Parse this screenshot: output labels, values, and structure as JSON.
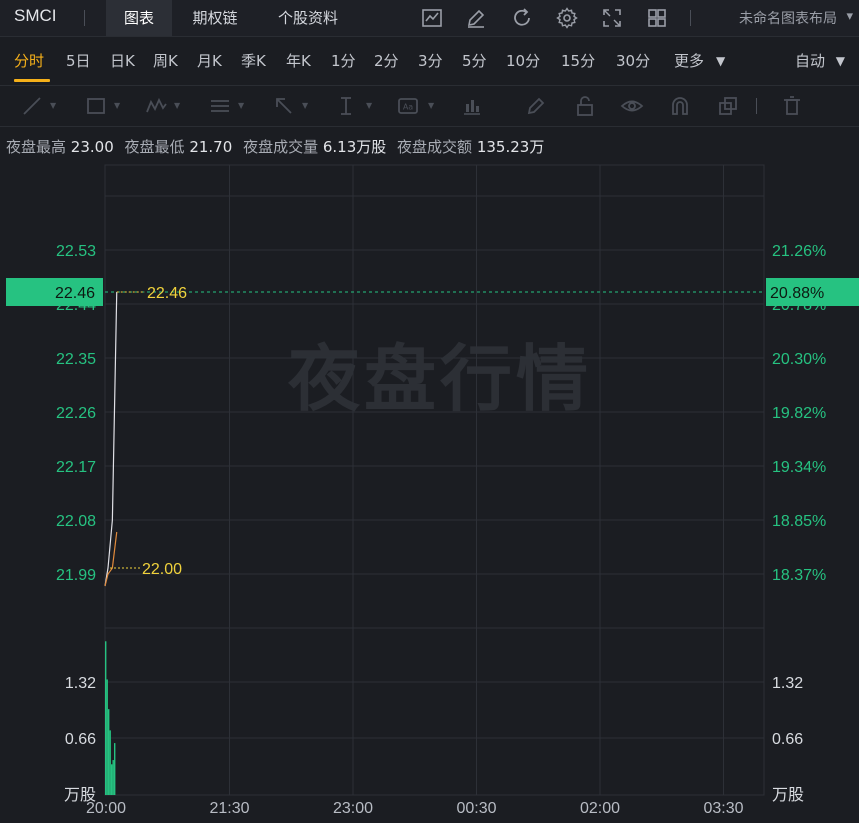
{
  "header": {
    "symbol": "SMCI",
    "tabs": [
      {
        "label": "图表",
        "active": true
      },
      {
        "label": "期权链",
        "active": false
      },
      {
        "label": "个股资料",
        "active": false
      }
    ],
    "icons": [
      "indicator-chart-icon",
      "draw-pen-icon",
      "refresh-icon",
      "settings-gear-icon",
      "fullscreen-icon",
      "layout-grid-icon"
    ],
    "layout_name": "未命名图表布局"
  },
  "intervals": {
    "items": [
      "分时",
      "5日",
      "日K",
      "周K",
      "月K",
      "季K",
      "年K",
      "1分",
      "2分",
      "3分",
      "5分",
      "10分",
      "15分",
      "30分",
      "更多"
    ],
    "active": "分时",
    "scale_mode": "自动"
  },
  "drawing_tools": [
    "trend-line-icon",
    "rectangle-icon",
    "pattern-icon",
    "fib-icon",
    "arrow-icon",
    "measure-icon",
    "text-label-icon",
    "chart-type-icon",
    "brush-icon",
    "lock-icon",
    "eye-icon",
    "magnet-icon",
    "layers-icon",
    "trash-icon"
  ],
  "stats": [
    {
      "label": "夜盘最高",
      "value": "23.00"
    },
    {
      "label": "夜盘最低",
      "value": "21.70"
    },
    {
      "label": "夜盘成交量",
      "value": "6.13万股"
    },
    {
      "label": "夜盘成交额",
      "value": "135.23万"
    }
  ],
  "watermark": "夜盘行情",
  "colors": {
    "accent": "#f5b01a",
    "up": "#26c281",
    "price_line": "#e0e0e6",
    "avg_line": "#e08a3c",
    "label_yellow": "#f0d23c"
  },
  "chart_data": {
    "type": "line",
    "price_axis": {
      "ticks": [
        22.53,
        22.44,
        22.35,
        22.26,
        22.17,
        22.08,
        21.99
      ],
      "tick_labels": [
        "22.53",
        "22.44",
        "22.35",
        "22.26",
        "22.17",
        "22.08",
        "21.99"
      ],
      "pct_labels": [
        "21.26%",
        "20.78%",
        "20.30%",
        "19.82%",
        "19.34%",
        "18.85%",
        "18.37%"
      ],
      "current_price": 22.46,
      "current_price_label": "22.46",
      "current_pct_label": "20.88%",
      "avg_marker": 22.0,
      "avg_marker_label": "22.00"
    },
    "volume_axis": {
      "ticks": [
        1.32,
        0.66
      ],
      "tick_labels": [
        "1.32",
        "0.66"
      ],
      "unit": "万股"
    },
    "time_axis": {
      "labels": [
        "20:00",
        "21:30",
        "23:00",
        "00:30",
        "02:00",
        "03:30"
      ]
    },
    "series": [
      {
        "values": [
          {
            "t": "20:00",
            "v": 21.97
          },
          {
            "t": "20:00",
            "v": 22.0
          },
          {
            "t": "20:01",
            "v": 22.08
          },
          {
            "t": "20:02",
            "v": 22.46
          }
        ]
      },
      {
        "values": [
          {
            "t": "20:00",
            "v": 21.97
          },
          {
            "t": "20:00",
            "v": 21.99
          },
          {
            "t": "20:01",
            "v": 22.0
          },
          {
            "t": "20:02",
            "v": 22.06
          }
        ]
      }
    ],
    "volume": [
      1.8,
      1.35,
      1.0,
      0.75,
      0.35,
      0.4,
      0.6
    ]
  }
}
